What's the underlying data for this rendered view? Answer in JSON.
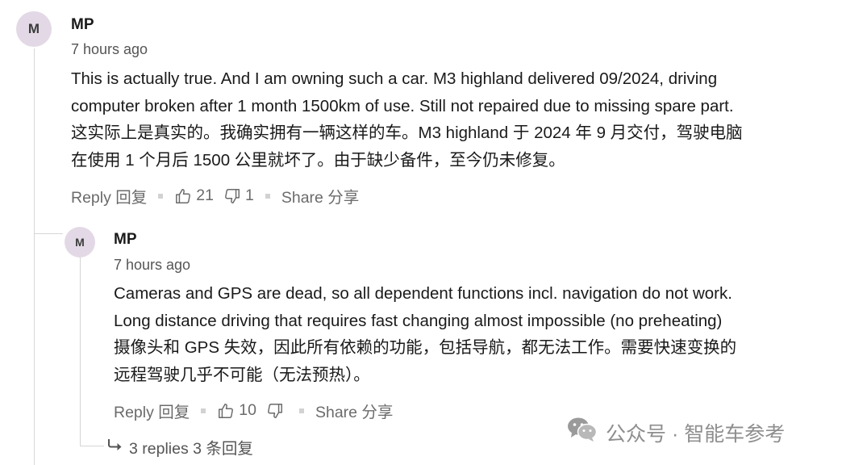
{
  "comment": {
    "avatar_letter": "M",
    "author": "MP",
    "time": "7 hours ago",
    "lines": [
      "This is actually true. And I am owning such a car. M3 highland delivered 09/2024, driving",
      "computer broken after 1 month 1500km of use. Still not repaired due to missing spare part.",
      "这实际上是真实的。我确实拥有一辆这样的车。M3 highland 于 2024 年 9 月交付，驾驶电脑",
      "在使用 1 个月后 1500 公里就坏了。由于缺少备件，至今仍未修复。"
    ],
    "reply_label": "Reply 回复",
    "likes": "21",
    "dislikes": "1",
    "share_label": "Share 分享"
  },
  "reply": {
    "avatar_letter": "M",
    "author": "MP",
    "time": "7 hours ago",
    "lines": [
      "Cameras and GPS are dead, so all dependent functions incl. navigation do not work.",
      "Long distance driving that requires fast changing almost impossible (no preheating)",
      "摄像头和 GPS 失效，因此所有依赖的功能，包括导航，都无法工作。需要快速变换的",
      "远程驾驶几乎不可能（无法预热）。"
    ],
    "reply_label": "Reply 回复",
    "likes": "10",
    "dislikes": "",
    "share_label": "Share 分享"
  },
  "replies_link": "3 replies 3 条回复",
  "watermark": "公众号 · 智能车参考",
  "colors": {
    "avatar_bg": "#e3d9e6",
    "text": "#1a1a1a",
    "muted": "#6b6b6b",
    "thread_line": "#d6d6d6"
  },
  "icons": [
    "thumbs-up-icon",
    "thumbs-down-icon",
    "reply-arrow-icon",
    "wechat-icon"
  ]
}
